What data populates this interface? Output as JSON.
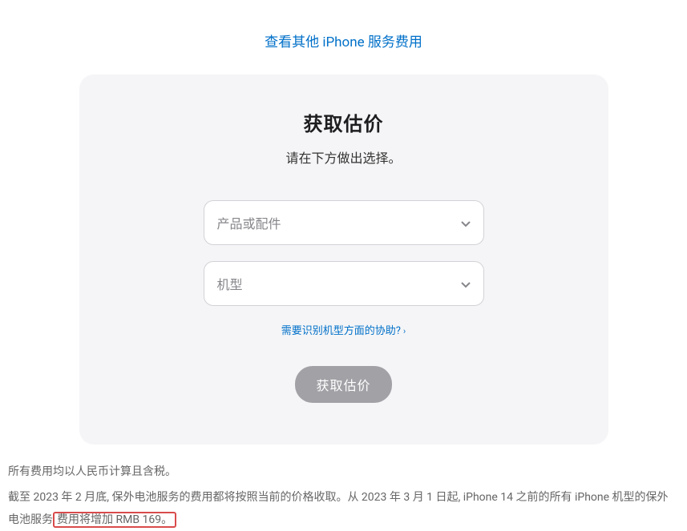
{
  "topLink": "查看其他 iPhone 服务费用",
  "card": {
    "title": "获取估价",
    "subtitle": "请在下方做出选择。",
    "select1Placeholder": "产品或配件",
    "select2Placeholder": "机型",
    "helpLink": "需要识别机型方面的协助?",
    "submitLabel": "获取估价"
  },
  "footer": {
    "line1": "所有费用均以人民币计算且含税。",
    "line2a": "截至 2023 年 2 月底, 保外电池服务的费用都将按照当前的价格收取。从 2023 年 3 月 1 日起, iPhone 14 之前的所有 iPhone 机型的保外电池服务",
    "line2b": "费用将增加 RMB 169。"
  }
}
